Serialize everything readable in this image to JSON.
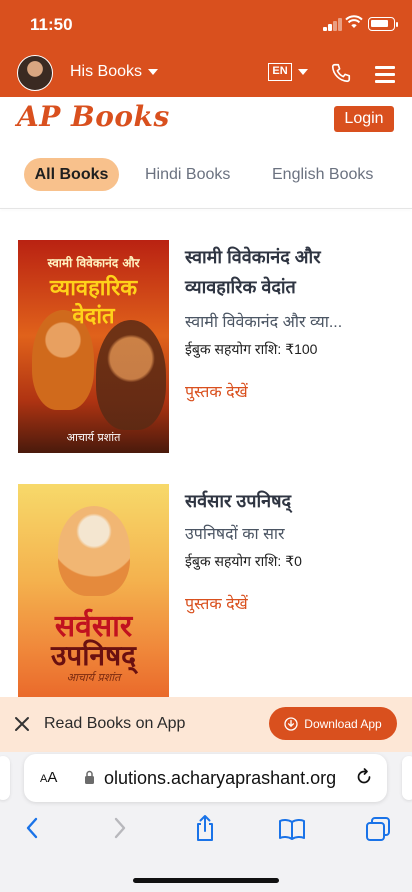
{
  "status_bar": {
    "time": "11:50"
  },
  "header": {
    "menu_label": "His Books",
    "language": "EN"
  },
  "brand": {
    "logo_text": "AP Books",
    "login_label": "Login"
  },
  "tabs": [
    {
      "label": "All Books",
      "active": true
    },
    {
      "label": "Hindi Books",
      "active": false
    },
    {
      "label": "English Books",
      "active": false
    }
  ],
  "books": [
    {
      "cover_line1": "स्वामी विवेकानंद और",
      "cover_line2": "व्यावहारिक",
      "cover_line3": "वेदांत",
      "cover_author": "आचार्य प्रशांत",
      "title": "स्वामी विवेकानंद और व्यावहारिक वेदांत",
      "subtitle": "स्वामी विवेकानंद और व्या...",
      "price": "ईबुक सहयोग राशि: ₹100",
      "view_label": "पुस्तक देखें"
    },
    {
      "cover_line1": "सर्वसार",
      "cover_line2": "उपनिषद्",
      "cover_author": "आचार्य प्रशांत",
      "title": "सर्वसार उपनिषद्",
      "subtitle": "उपनिषदों का सार",
      "price": "ईबुक सहयोग राशि: ₹0",
      "view_label": "पुस्तक देखें"
    }
  ],
  "banner": {
    "text": "Read Books on App",
    "button_label": "Download App"
  },
  "browser": {
    "aa_label": "AA",
    "url": "olutions.acharyaprashant.org"
  },
  "colors": {
    "accent": "#d9501e",
    "tab_active_bg": "#f8c18c",
    "banner_bg": "#fde7d6"
  }
}
